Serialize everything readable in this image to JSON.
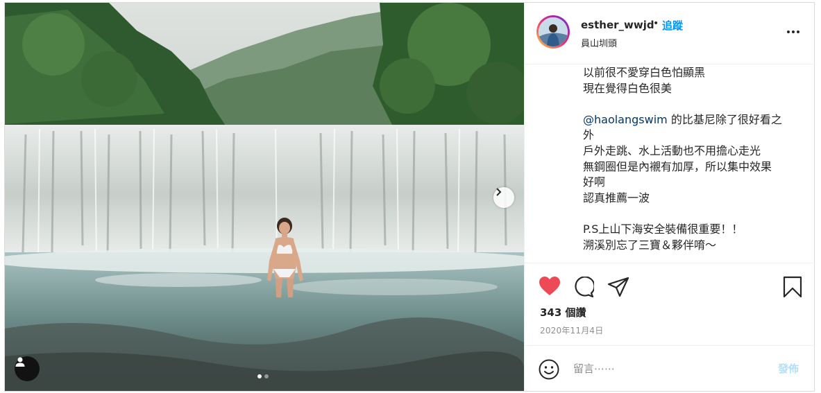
{
  "colors": {
    "accent": "#0095f6",
    "like": "#ed4956",
    "mention": "#00376b",
    "muted": "#8e8e8e",
    "post_disabled": "#b2dffc"
  },
  "photo": {
    "alt_subject": "woman in white bikini standing in river in front of waterfall",
    "slide_index": 1,
    "slide_count": 2
  },
  "header": {
    "username": "esther_wwjd",
    "separator": "•",
    "follow_label": "追蹤",
    "location": "員山圳頭",
    "more_icon": "more-horizontal-icon"
  },
  "caption": {
    "lines": [
      {
        "text": "以前很不愛穿白色怕顯黑"
      },
      {
        "text": "現在覺得白色很美"
      },
      {
        "text": ""
      },
      {
        "mention": "@haolangswim",
        "text": " 的比基尼除了很好看之"
      },
      {
        "text": "外"
      },
      {
        "text": "戶外走跳、水上活動也不用擔心走光"
      },
      {
        "text": "無鋼圈但是內襯有加厚，所以集中效果"
      },
      {
        "text": "好啊"
      },
      {
        "text": "認真推薦一波"
      },
      {
        "text": ""
      },
      {
        "text": "P.S上山下海安全裝備很重要！！"
      },
      {
        "text": "溯溪別忘了三寶＆夥伴唷～"
      }
    ]
  },
  "actions": {
    "like_icon": "heart-filled-icon",
    "comment_icon": "comment-icon",
    "share_icon": "paper-plane-icon",
    "save_icon": "bookmark-icon",
    "likes_text": "343 個讚",
    "likes_count": 343,
    "date": "2020年11月4日"
  },
  "comment_box": {
    "emoji_icon": "smiley-icon",
    "placeholder": "留言⋯⋯",
    "post_label": "發佈"
  }
}
